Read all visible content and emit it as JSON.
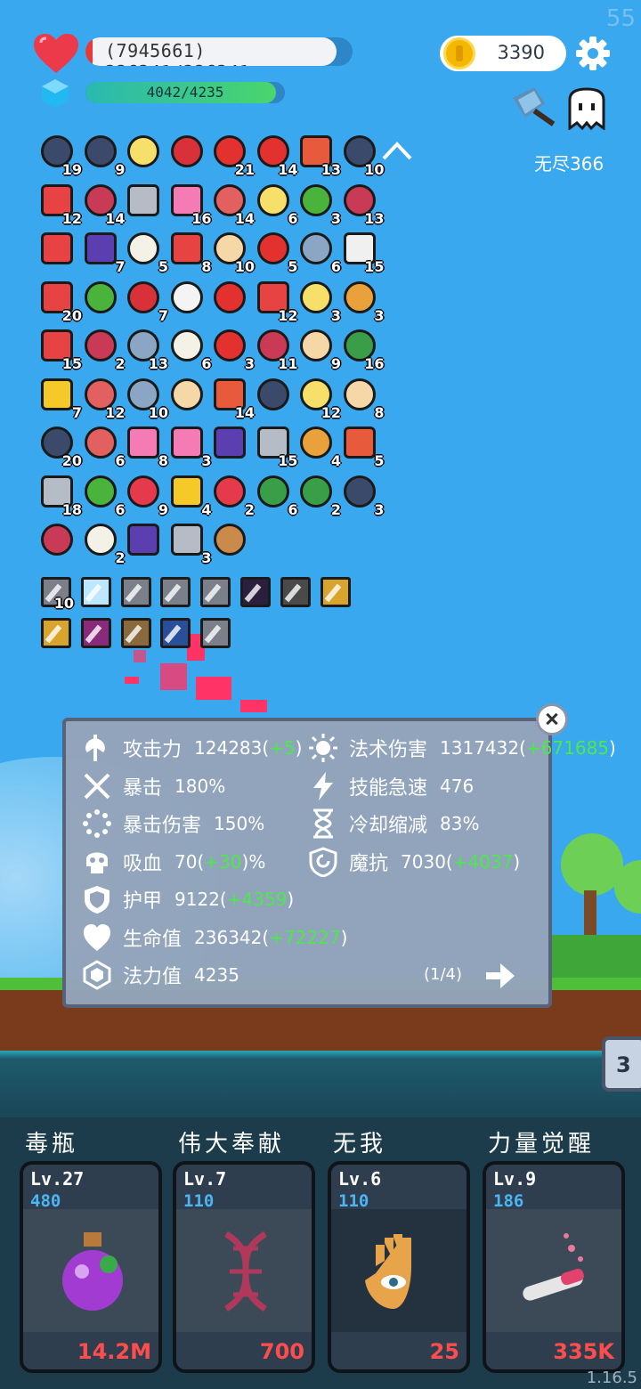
{
  "hud": {
    "fps": "55",
    "hp_text": "(7945661) 236341/236341",
    "hp_fraction": 0.94,
    "mp_text": "4042/4235",
    "mp_fraction": 0.955,
    "coins": "3390",
    "mode_label": "无尽366",
    "icons": [
      "heart-icon",
      "mana-crystal-icon",
      "coin-icon",
      "gear-icon",
      "axe-icon",
      "ghost-icon"
    ]
  },
  "items": {
    "rows": [
      [
        {
          "icon": "donut",
          "c": "19"
        },
        {
          "icon": "jam-jar",
          "c": "9"
        },
        {
          "icon": "skull-book",
          "c": ""
        },
        {
          "icon": "magnifier",
          "c": ""
        },
        {
          "icon": "sword",
          "c": "21"
        },
        {
          "icon": "flower",
          "c": "14"
        },
        {
          "icon": "sock",
          "c": "13"
        },
        {
          "icon": "apple",
          "c": "10"
        }
      ],
      [
        {
          "icon": "watermelon",
          "c": "12"
        },
        {
          "icon": "crown",
          "c": "14"
        },
        {
          "icon": "magnet",
          "c": ""
        },
        {
          "icon": "cards",
          "c": "16"
        },
        {
          "icon": "double-axe",
          "c": "14"
        },
        {
          "icon": "book",
          "c": "6"
        },
        {
          "icon": "steak",
          "c": "3"
        },
        {
          "icon": "pill",
          "c": "13"
        }
      ],
      [
        {
          "icon": "map",
          "c": ""
        },
        {
          "icon": "gift",
          "c": "7"
        },
        {
          "icon": "hat",
          "c": "5"
        },
        {
          "icon": "note",
          "c": "8"
        },
        {
          "icon": "potion-flag",
          "c": "10"
        },
        {
          "icon": "spray",
          "c": "5"
        },
        {
          "icon": "heart",
          "c": "6"
        },
        {
          "icon": "helmet",
          "c": "15"
        }
      ],
      [
        {
          "icon": "ice-cream",
          "c": "20"
        },
        {
          "icon": "speech",
          "c": ""
        },
        {
          "icon": "slime",
          "c": "7"
        },
        {
          "icon": "love-letter",
          "c": ""
        },
        {
          "icon": "chest",
          "c": ""
        },
        {
          "icon": "grenade",
          "c": "12"
        },
        {
          "icon": "coconut",
          "c": "3"
        },
        {
          "icon": "sunflower",
          "c": "3"
        }
      ],
      [
        {
          "icon": "fist",
          "c": "15"
        },
        {
          "icon": "gem",
          "c": "2"
        },
        {
          "icon": "door",
          "c": "13"
        },
        {
          "icon": "strawberry",
          "c": "6"
        },
        {
          "icon": "cloud",
          "c": "3"
        },
        {
          "icon": "hook",
          "c": "11"
        },
        {
          "icon": "star-shield",
          "c": "9"
        },
        {
          "icon": "bat",
          "c": "16"
        }
      ],
      [
        {
          "icon": "red-shield",
          "c": "7"
        },
        {
          "icon": "compass",
          "c": "12"
        },
        {
          "icon": "meteor",
          "c": "10"
        },
        {
          "icon": "cauldron",
          "c": ""
        },
        {
          "icon": "money",
          "c": "14"
        },
        {
          "icon": "tarot",
          "c": ""
        },
        {
          "icon": "egg",
          "c": "12"
        },
        {
          "icon": "bow",
          "c": "8"
        }
      ],
      [
        {
          "icon": "mushroom",
          "c": "20"
        },
        {
          "icon": "crosshair",
          "c": "6"
        },
        {
          "icon": "dice",
          "c": "8"
        },
        {
          "icon": "ghost",
          "c": "3"
        },
        {
          "icon": "wand",
          "c": ""
        },
        {
          "icon": "spike-ball",
          "c": "15"
        },
        {
          "icon": "bulb",
          "c": "4"
        },
        {
          "icon": "ring",
          "c": "5"
        }
      ],
      [
        {
          "icon": "sun-bird",
          "c": "18"
        },
        {
          "icon": "clipboard",
          "c": "6"
        },
        {
          "icon": "blue-shield",
          "c": "9"
        },
        {
          "icon": "star-card",
          "c": "4"
        },
        {
          "icon": "envelope",
          "c": "2"
        },
        {
          "icon": "hearts",
          "c": "6"
        },
        {
          "icon": "target",
          "c": "2"
        },
        {
          "icon": "crystal-ball",
          "c": "3"
        }
      ],
      [
        {
          "icon": "flask",
          "c": ""
        },
        {
          "icon": "capsule",
          "c": "2"
        },
        {
          "icon": "mustache",
          "c": ""
        },
        {
          "icon": "coins",
          "c": "3"
        },
        {
          "icon": "thermometer",
          "c": ""
        }
      ]
    ],
    "cards_row1": [
      {
        "icon": "blade-card",
        "c": "10"
      },
      {
        "icon": "light-card",
        "c": ""
      },
      {
        "icon": "blade-card",
        "c": ""
      },
      {
        "icon": "blade-card",
        "c": ""
      },
      {
        "icon": "blade-card",
        "c": ""
      },
      {
        "icon": "dark-card",
        "c": ""
      },
      {
        "icon": "armor-card",
        "c": ""
      },
      {
        "icon": "gold-armor-card",
        "c": ""
      }
    ],
    "cards_row2": [
      {
        "icon": "gold-blade-card",
        "c": ""
      },
      {
        "icon": "pink-monster-card",
        "c": ""
      },
      {
        "icon": "green-check-card",
        "c": ""
      },
      {
        "icon": "blue-wolf-card",
        "c": ""
      },
      {
        "icon": "blade-card",
        "c": ""
      }
    ]
  },
  "stats": {
    "left": [
      {
        "icon": "axe-icon",
        "name": "攻击力",
        "value": "124283",
        "plus": "+5"
      },
      {
        "icon": "crit-icon",
        "name": "暴击",
        "value": "180%",
        "plus": ""
      },
      {
        "icon": "crit-damage-icon",
        "name": "暴击伤害",
        "value": "150%",
        "plus": ""
      },
      {
        "icon": "skull-icon",
        "name": "吸血",
        "value": "70",
        "plus": "+30",
        "suffix": "%"
      },
      {
        "icon": "armor-icon",
        "name": "护甲",
        "value": "9122",
        "plus": "+4359"
      },
      {
        "icon": "heart-icon",
        "name": "生命值",
        "value": "236342",
        "plus": "+72227"
      },
      {
        "icon": "mana-icon",
        "name": "法力值",
        "value": "4235",
        "plus": ""
      }
    ],
    "right": [
      {
        "icon": "sun-icon",
        "name": "法术伤害",
        "value": "1317432",
        "plus": "+671685"
      },
      {
        "icon": "lightning-icon",
        "name": "技能急速",
        "value": "476",
        "plus": ""
      },
      {
        "icon": "hourglass-icon",
        "name": "冷却缩减",
        "value": "83%",
        "plus": ""
      },
      {
        "icon": "magic-shield-icon",
        "name": "魔抗",
        "value": "7030",
        "plus": "+4037"
      }
    ],
    "page": "(1/4)"
  },
  "side_tab": "3",
  "skills": [
    {
      "title": "毒瓶",
      "level": "Lv.27",
      "cost": "480",
      "price": "14.2M",
      "art": "poison-bottle-icon"
    },
    {
      "title": "伟大奉献",
      "level": "Lv.7",
      "cost": "110",
      "price": "700",
      "art": "dna-icon"
    },
    {
      "title": "无我",
      "level": "Lv.6",
      "cost": "110",
      "price": "25",
      "art": "eye-hand-icon"
    },
    {
      "title": "力量觉醒",
      "level": "Lv.9",
      "cost": "186",
      "price": "335K",
      "art": "test-tube-icon"
    }
  ],
  "version": "1.16.5",
  "colors": {
    "sky": "#39a8ef",
    "panel": "#94a4ba",
    "plus_green": "#4ce94a",
    "price_red": "#ff4d4d",
    "cost_blue": "#4ab6f6"
  }
}
